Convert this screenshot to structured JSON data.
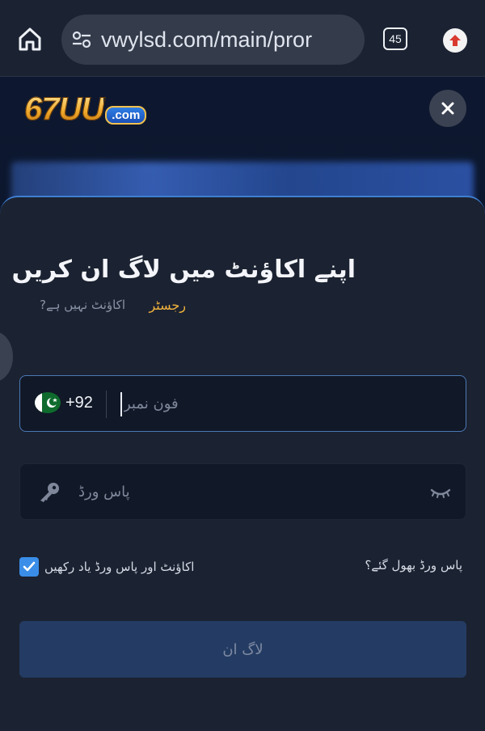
{
  "browser": {
    "url": "vwylsd.com/main/pror",
    "tab_count": "45"
  },
  "brand": {
    "logo_number": "67UU",
    "logo_suffix": ".com"
  },
  "login": {
    "title": "اپنے اکاؤنٹ میں لاگ ان کریں",
    "no_account_text": "اکاؤنٹ نہیں ہے?",
    "register_link": "رجسٹر",
    "phone": {
      "country_code": "+92",
      "country_flag": "pakistan-flag",
      "placeholder": "فون نمبر",
      "value": ""
    },
    "password": {
      "placeholder": "پاس ورڈ",
      "value": ""
    },
    "remember_label": "اکاؤنٹ اور پاس ورڈ یاد رکھیں",
    "remember_checked": true,
    "forgot_link": "پاس ورڈ بھول گئے؟",
    "submit_label": "لاگ ان"
  },
  "colors": {
    "accent_blue": "#3a8ee8",
    "link_gold": "#f0b23d",
    "sheet_bg": "#1b2231",
    "button_disabled": "#243c63"
  }
}
